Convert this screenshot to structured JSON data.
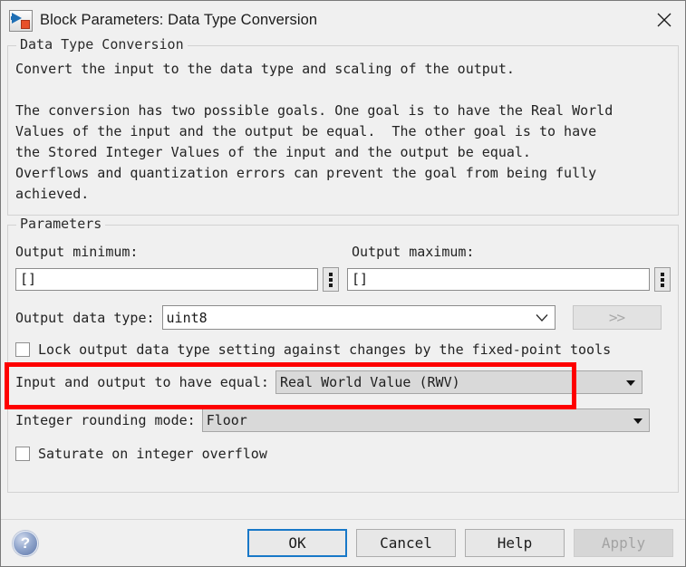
{
  "window": {
    "title": "Block Parameters: Data Type Conversion",
    "icon": "simulink-block-icon",
    "close_icon": "close-icon"
  },
  "description_group": {
    "legend": "Data Type Conversion",
    "text": "Convert the input to the data type and scaling of the output.\n\nThe conversion has two possible goals. One goal is to have the Real World\nValues of the input and the output be equal.  The other goal is to have\nthe Stored Integer Values of the input and the output be equal.\nOverflows and quantization errors can prevent the goal from being fully\nachieved."
  },
  "parameters_group": {
    "legend": "Parameters",
    "output_minimum": {
      "label": "Output minimum:",
      "value": "[]",
      "placeholder": "",
      "side_button_icon": "vertical-dots-icon"
    },
    "output_maximum": {
      "label": "Output maximum:",
      "value": "[]",
      "placeholder": "",
      "side_button_icon": "vertical-dots-icon"
    },
    "output_data_type": {
      "label": "Output data type:",
      "value": "uint8",
      "dropdown_icon": "chevron-down-icon",
      "highlighted": true,
      "highlight_color": "#fe0000"
    },
    "advance_button": {
      "label": ">>",
      "enabled": false
    },
    "lock_checkbox": {
      "label": "Lock output data type setting against changes by the fixed-point tools",
      "checked": false
    },
    "input_output_equal": {
      "label": "Input and output to have equal:",
      "value": "Real World Value (RWV)",
      "dropdown_icon": "triangle-down-icon"
    },
    "integer_rounding_mode": {
      "label": "Integer rounding mode:",
      "value": "Floor",
      "dropdown_icon": "triangle-down-icon"
    },
    "saturate_checkbox": {
      "label": "Saturate on integer overflow",
      "checked": false
    }
  },
  "footer": {
    "help_icon": "help-question-icon",
    "ok_label": "OK",
    "cancel_label": "Cancel",
    "help_label": "Help",
    "apply_label": "Apply",
    "apply_enabled": false,
    "focus_color": "#1878c8"
  }
}
